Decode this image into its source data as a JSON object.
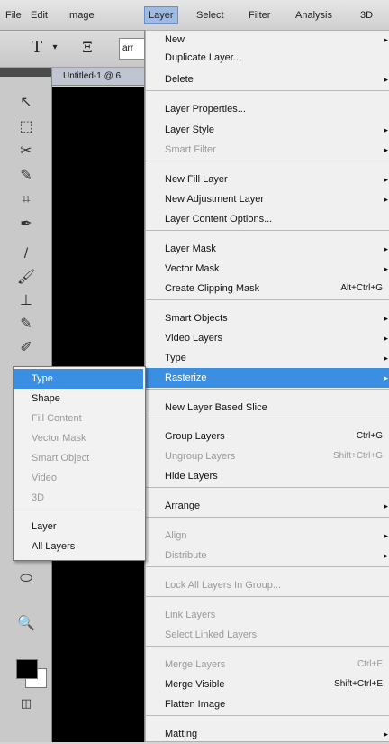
{
  "menubar": {
    "items": [
      "File",
      "Edit",
      "Image",
      "Layer",
      "Select",
      "Filter",
      "Analysis",
      "3D"
    ]
  },
  "options": {
    "tool1": "T",
    "tool2": "Ξ",
    "font_field": "arr"
  },
  "document": {
    "tab_title": "Untitled-1 @ 6"
  },
  "tools": [
    "↖",
    "⬚",
    "✂",
    "✎",
    "⌗",
    "✒",
    "/",
    "🖌",
    "⊥",
    "✎",
    "✐",
    "⬭",
    "🔍"
  ],
  "layer_menu": {
    "items": [
      {
        "label": "New",
        "submenu": true
      },
      {
        "label": "Duplicate Layer..."
      },
      {
        "label": "Delete",
        "submenu": true
      },
      {
        "label": "Layer Properties..."
      },
      {
        "label": "Layer Style",
        "submenu": true
      },
      {
        "label": "Smart Filter",
        "submenu": true,
        "disabled": true
      },
      {
        "label": "New Fill Layer",
        "submenu": true
      },
      {
        "label": "New Adjustment Layer",
        "submenu": true
      },
      {
        "label": "Layer Content Options..."
      },
      {
        "label": "Layer Mask",
        "submenu": true
      },
      {
        "label": "Vector Mask",
        "submenu": true
      },
      {
        "label": "Create Clipping Mask",
        "shortcut": "Alt+Ctrl+G"
      },
      {
        "label": "Smart Objects",
        "submenu": true
      },
      {
        "label": "Video Layers",
        "submenu": true
      },
      {
        "label": "Type",
        "submenu": true
      },
      {
        "label": "Rasterize",
        "submenu": true,
        "highlighted": true
      },
      {
        "label": "New Layer Based Slice"
      },
      {
        "label": "Group Layers",
        "shortcut": "Ctrl+G"
      },
      {
        "label": "Ungroup Layers",
        "shortcut": "Shift+Ctrl+G",
        "disabled": true
      },
      {
        "label": "Hide Layers"
      },
      {
        "label": "Arrange",
        "submenu": true
      },
      {
        "label": "Align",
        "submenu": true,
        "disabled": true
      },
      {
        "label": "Distribute",
        "submenu": true,
        "disabled": true
      },
      {
        "label": "Lock All Layers In Group...",
        "disabled": true
      },
      {
        "label": "Link Layers",
        "disabled": true
      },
      {
        "label": "Select Linked Layers",
        "disabled": true
      },
      {
        "label": "Merge Layers",
        "shortcut": "Ctrl+E",
        "disabled": true
      },
      {
        "label": "Merge Visible",
        "shortcut": "Shift+Ctrl+E"
      },
      {
        "label": "Flatten Image"
      },
      {
        "label": "Matting",
        "submenu": true
      }
    ]
  },
  "rasterize_submenu": {
    "items": [
      {
        "label": "Type",
        "highlighted": true
      },
      {
        "label": "Shape"
      },
      {
        "label": "Fill Content",
        "disabled": true
      },
      {
        "label": "Vector Mask",
        "disabled": true
      },
      {
        "label": "Smart Object",
        "disabled": true
      },
      {
        "label": "Video",
        "disabled": true
      },
      {
        "label": "3D",
        "disabled": true
      },
      {
        "label": "Layer"
      },
      {
        "label": "All Layers"
      }
    ]
  },
  "colors": {
    "highlight": "#3b8fe2",
    "disabled_text": "#9a9a9a"
  }
}
